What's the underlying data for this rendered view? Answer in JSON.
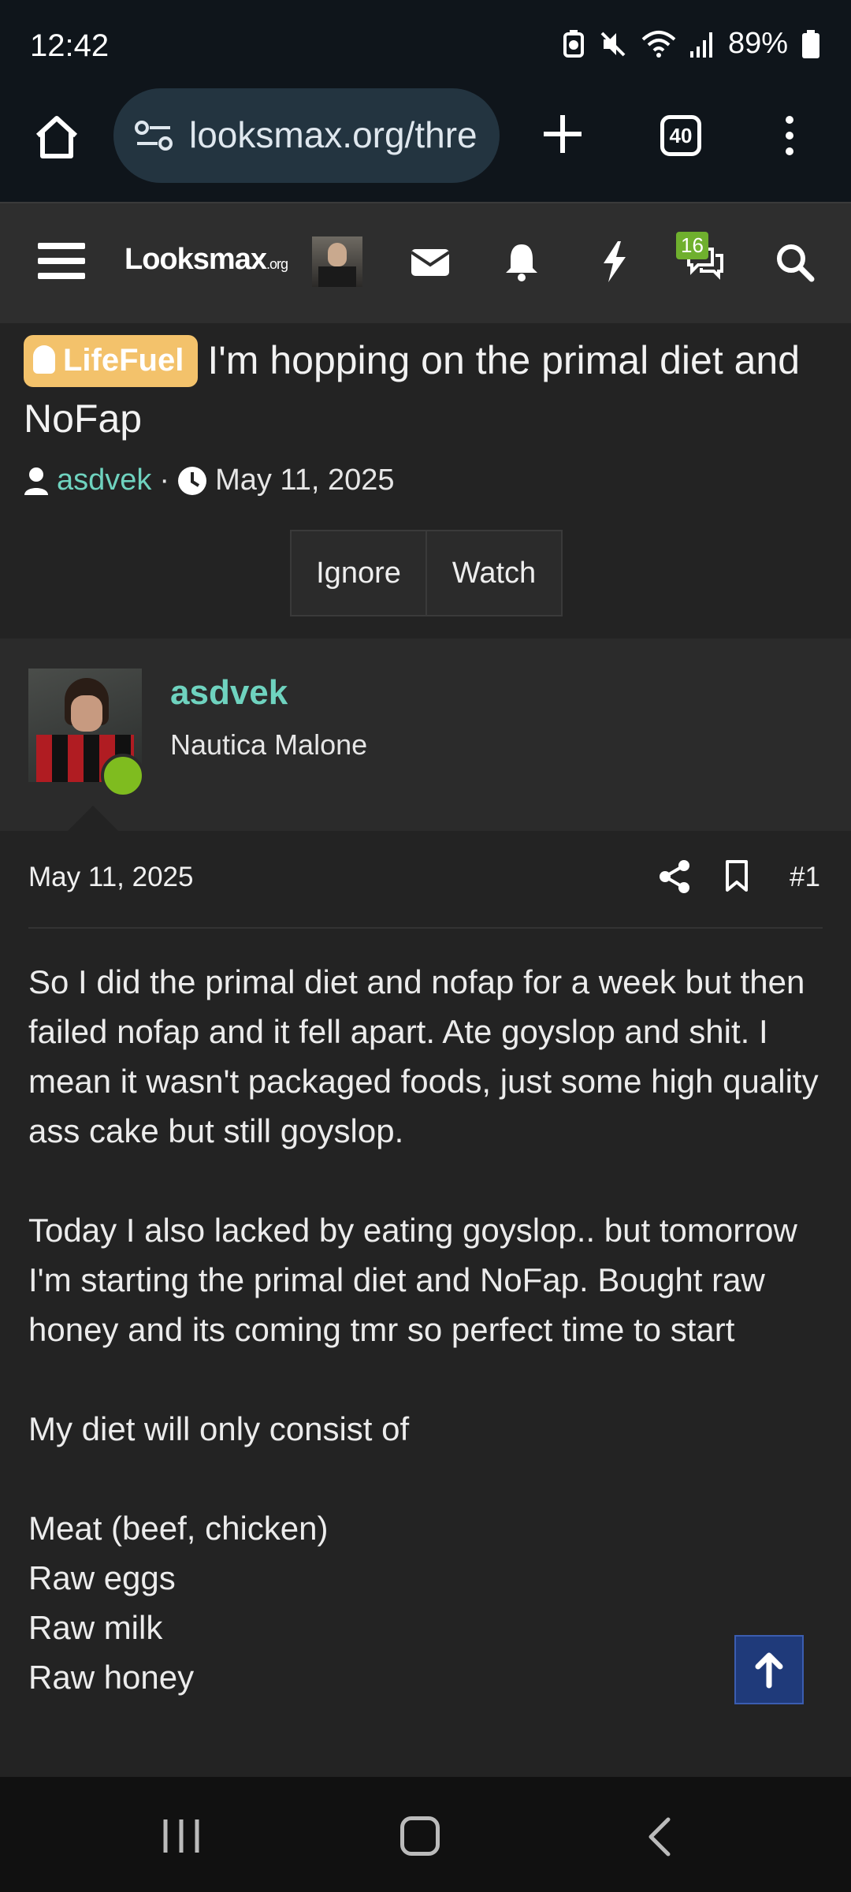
{
  "status_bar": {
    "time": "12:42",
    "battery": "89%",
    "icons": [
      "battery-saver-icon",
      "mute-icon",
      "wifi-icon",
      "signal-icon",
      "battery-icon"
    ]
  },
  "browser": {
    "url": "looksmax.org/thre",
    "tab_count": "40"
  },
  "forum_nav": {
    "logo_main": "Looksmax",
    "logo_suffix": ".org",
    "chat_badge": "16",
    "accent": "#6fb02e"
  },
  "thread": {
    "prefix": "LifeFuel",
    "title": "I'm hopping on the primal diet and NoFap",
    "author": "asdvek",
    "separator": "·",
    "date": "May 11, 2025",
    "ignore_label": "Ignore",
    "watch_label": "Watch"
  },
  "post": {
    "username": "asdvek",
    "user_title": "Nautica Malone",
    "date": "May 11, 2025",
    "number": "#1",
    "paragraphs": [
      "So I did the primal diet and nofap for a week but then failed nofap and it fell apart. Ate goyslop and shit. I mean it wasn't packaged foods, just some high quality ass cake but still goyslop.",
      "Today I also lacked by eating goyslop.. but tomorrow I'm starting the primal diet and NoFap. Bought raw honey and its coming tmr so perfect time to start",
      "My diet will only consist of"
    ],
    "list": [
      "Meat (beef, chicken)",
      "Raw eggs",
      "Raw milk",
      "Raw honey"
    ]
  },
  "colors": {
    "username": "#6fd3bf",
    "prefix_badge": "#f3c26b",
    "online": "#7fbc1f",
    "scroll_button": "#1f3a7a"
  }
}
